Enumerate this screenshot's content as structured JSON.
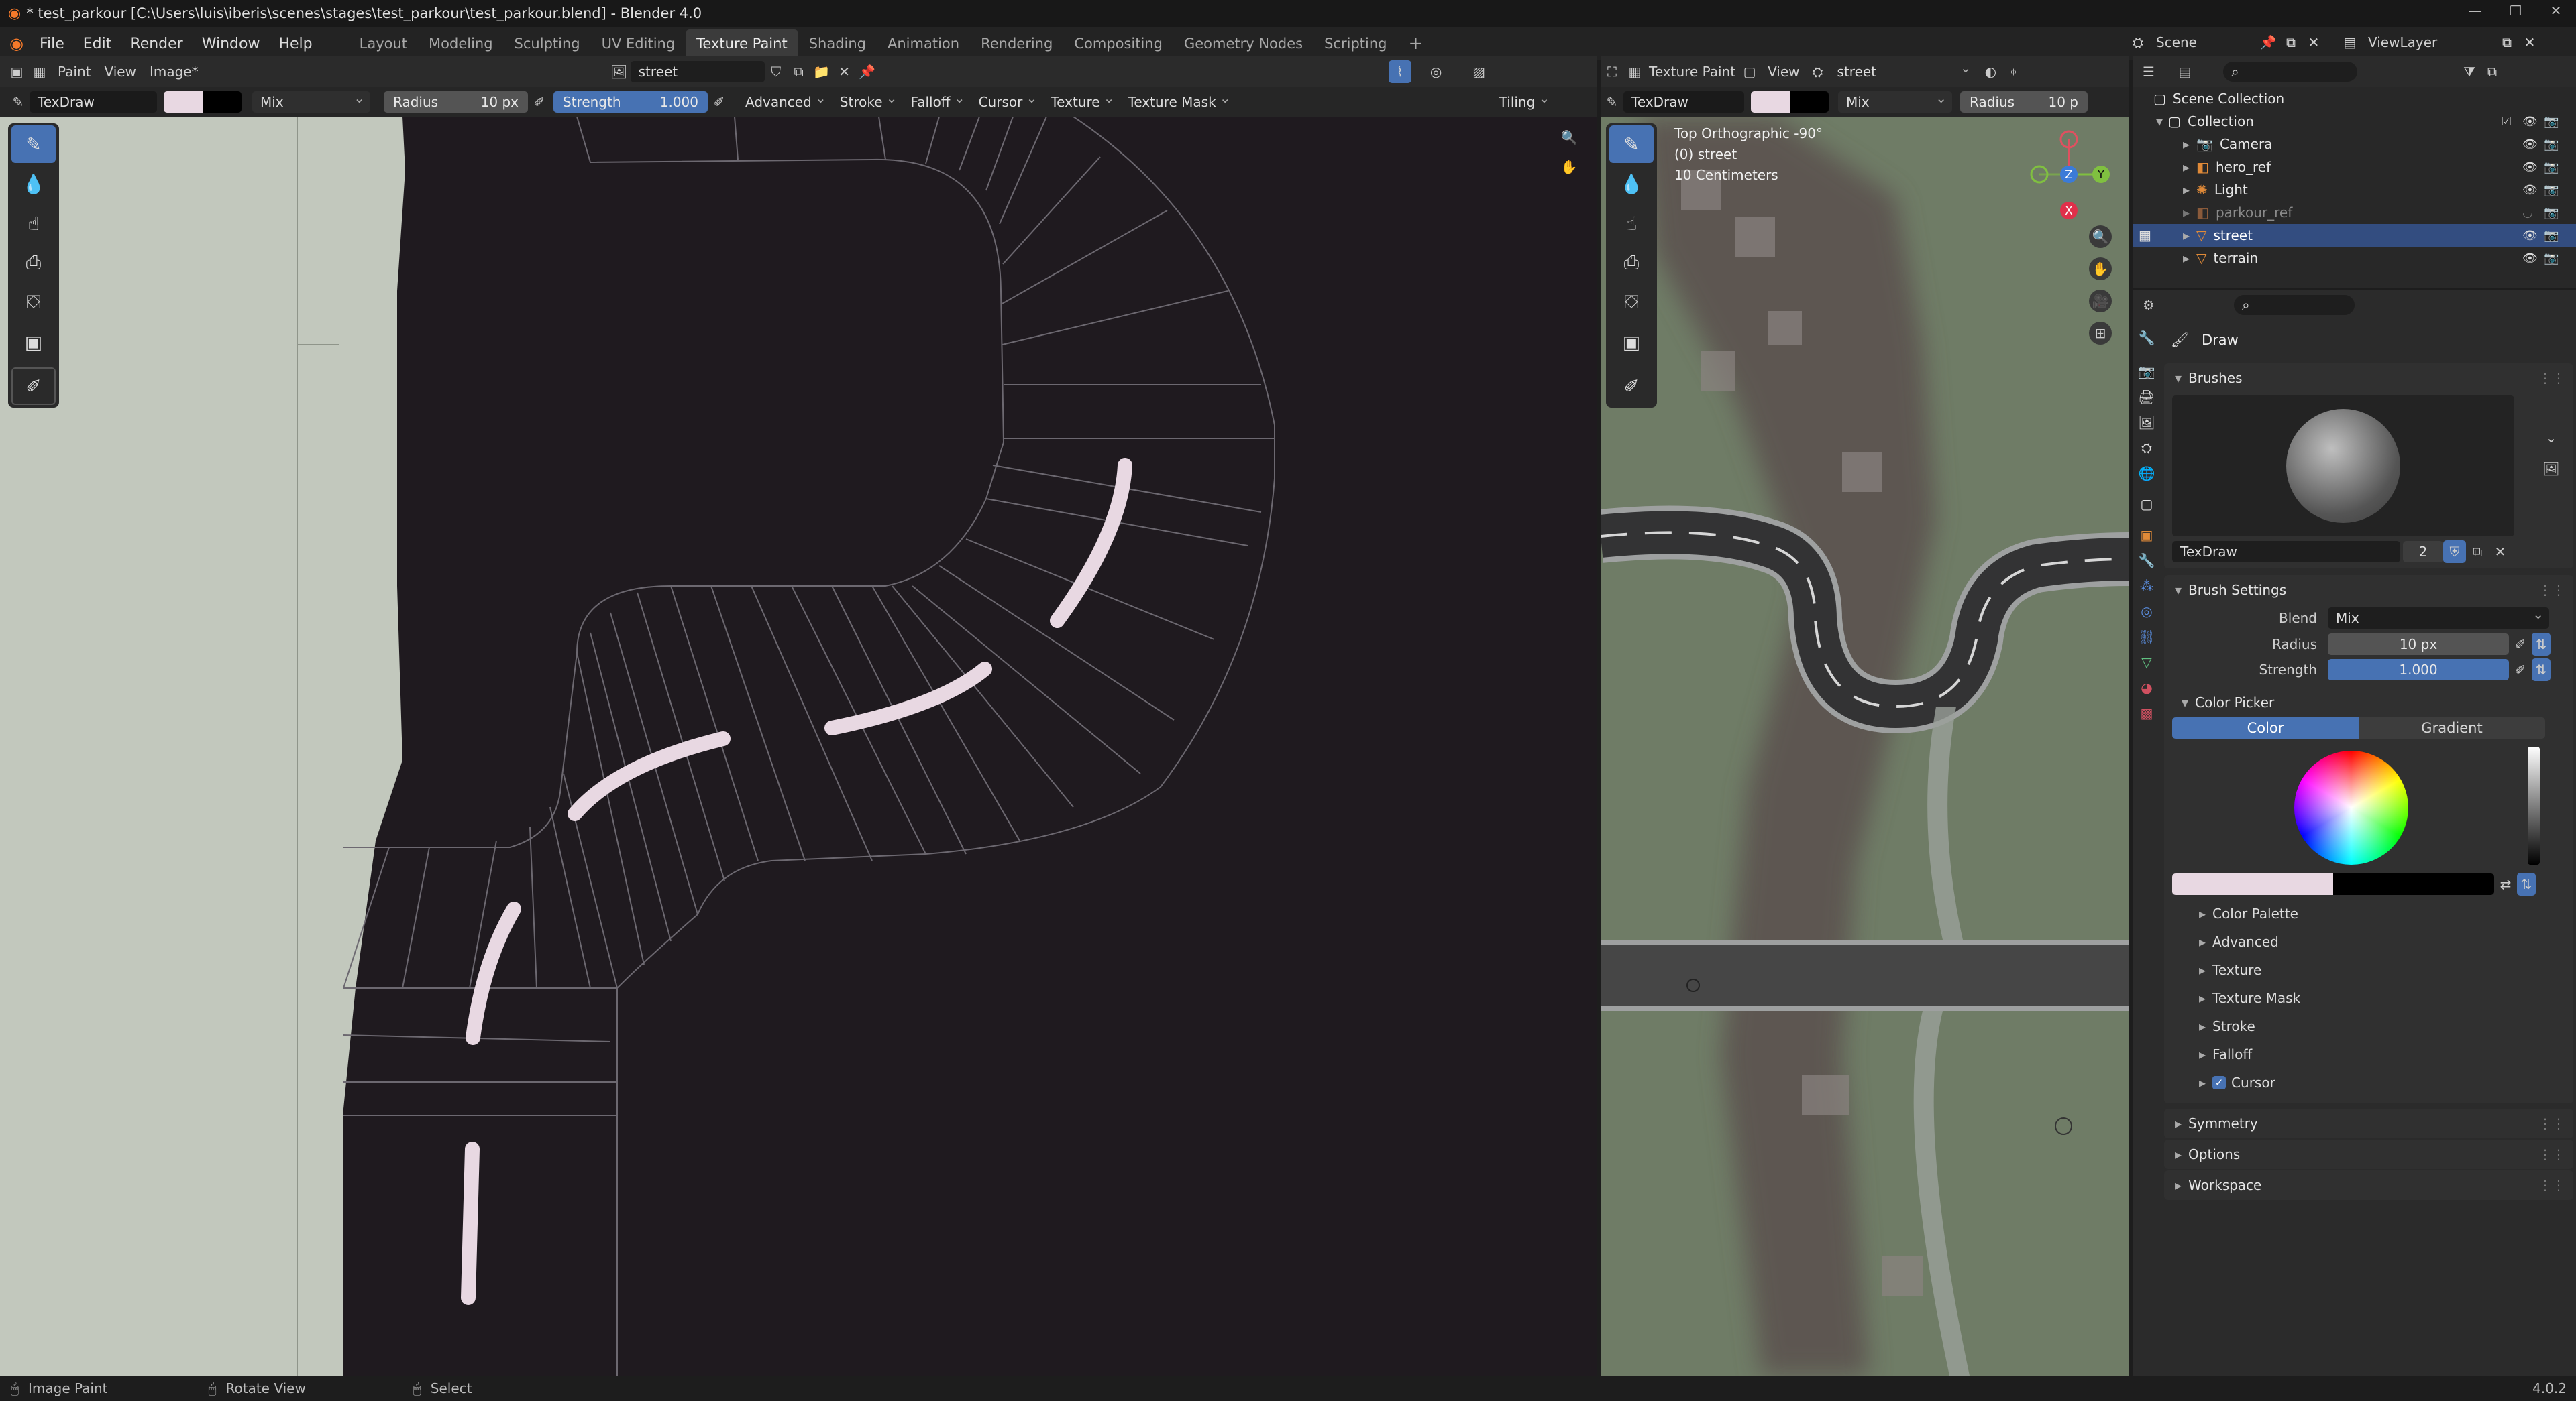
{
  "window": {
    "title": "* test_parkour [C:\\Users\\luis\\iberis\\scenes\\stages\\test_parkour\\test_parkour.blend] - Blender 4.0",
    "min": "—",
    "max": "❐",
    "close": "✕"
  },
  "menu": [
    "File",
    "Edit",
    "Render",
    "Window",
    "Help"
  ],
  "workspaces": [
    "Layout",
    "Modeling",
    "Sculpting",
    "UV Editing",
    "Texture Paint",
    "Shading",
    "Animation",
    "Rendering",
    "Compositing",
    "Geometry Nodes",
    "Scripting"
  ],
  "active_workspace": "Texture Paint",
  "scene": "Scene",
  "view_layer": "ViewLayer",
  "image_editor": {
    "header": {
      "mode": "Paint",
      "view": "View",
      "image_menu": "Image*",
      "image_name": "street"
    },
    "tool_settings": {
      "brush": "TexDraw",
      "blend": "Mix",
      "radius_label": "Radius",
      "radius_value": "10 px",
      "strength_label": "Strength",
      "strength_value": "1.000",
      "menus": [
        "Advanced",
        "Stroke",
        "Falloff",
        "Cursor",
        "Texture",
        "Texture Mask"
      ],
      "tiling": "Tiling"
    }
  },
  "viewport": {
    "header": {
      "mode": "Texture Paint",
      "view": "View",
      "object": "street"
    },
    "tool_settings": {
      "brush": "TexDraw",
      "blend": "Mix",
      "radius_label": "Radius",
      "radius_value": "10 p"
    },
    "overlay": {
      "line1": "Top Orthographic -90°",
      "line2": "(0) street",
      "line3": "10 Centimeters"
    },
    "gizmo": {
      "x": "X",
      "y": "Y",
      "z": "Z"
    }
  },
  "outliner": {
    "root": "Scene Collection",
    "collection": "Collection",
    "items": [
      {
        "name": "Camera",
        "icon": "📷",
        "color": "#e08a38",
        "selected": false,
        "dim": false
      },
      {
        "name": "hero_ref",
        "icon": "◧",
        "color": "#e08a38",
        "selected": false,
        "dim": false
      },
      {
        "name": "Light",
        "icon": "💡",
        "color": "#e08a38",
        "selected": false,
        "dim": false
      },
      {
        "name": "parkour_ref",
        "icon": "◧",
        "color": "#8a5a3a",
        "selected": false,
        "dim": true
      },
      {
        "name": "street",
        "icon": "▽",
        "color": "#e08a38",
        "selected": true,
        "dim": false
      },
      {
        "name": "terrain",
        "icon": "▽",
        "color": "#e08a38",
        "selected": false,
        "dim": false
      }
    ]
  },
  "properties": {
    "tool_name": "Draw",
    "brushes_label": "Brushes",
    "brush_name": "TexDraw",
    "brush_users": "2",
    "brush_settings_label": "Brush Settings",
    "blend_label": "Blend",
    "blend_value": "Mix",
    "radius_label": "Radius",
    "radius_value": "10 px",
    "strength_label": "Strength",
    "strength_value": "1.000",
    "color_picker_label": "Color Picker",
    "color_tab": "Color",
    "gradient_tab": "Gradient",
    "subsections": [
      "Color Palette",
      "Advanced",
      "Texture",
      "Texture Mask",
      "Stroke",
      "Falloff",
      "Cursor"
    ],
    "sections": [
      "Symmetry",
      "Options",
      "Workspace"
    ],
    "primary_color": "#e8d8e2",
    "secondary_color": "#000000"
  },
  "status": {
    "left": "Image Paint",
    "middle": "Rotate View",
    "right": "Select",
    "version": "4.0.2"
  }
}
